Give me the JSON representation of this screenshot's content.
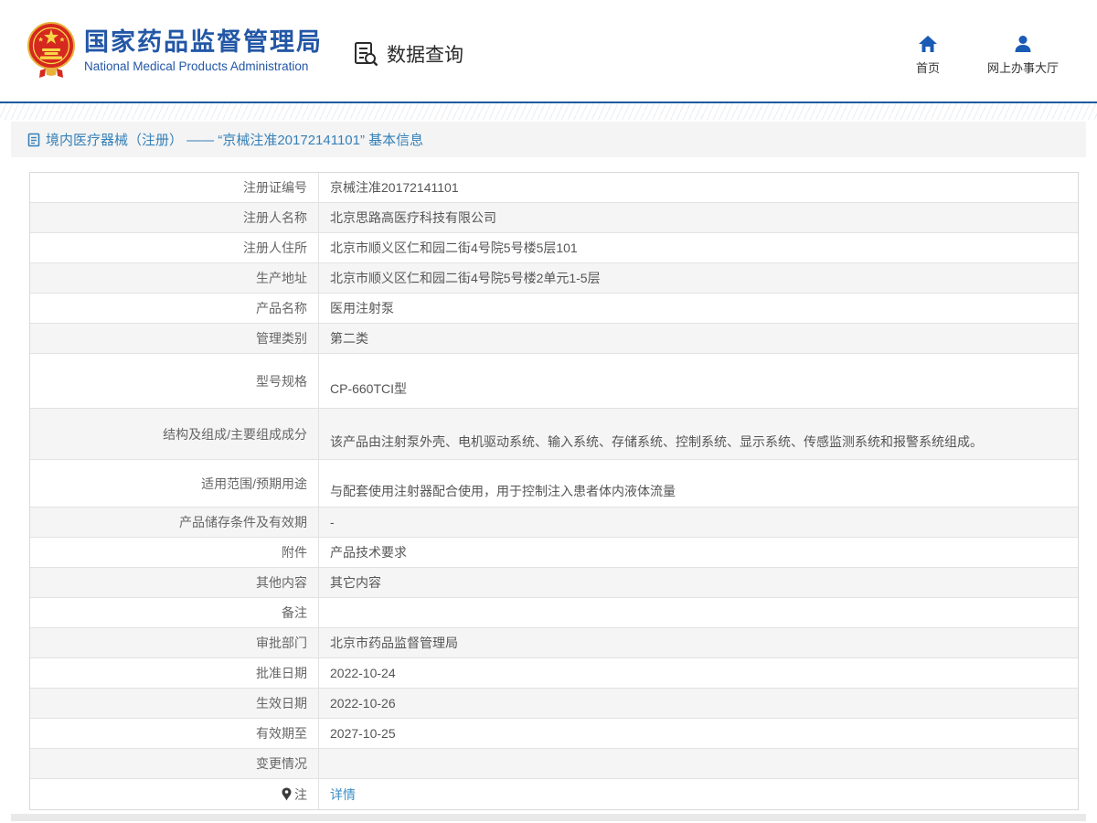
{
  "header": {
    "org_title": "国家药品监督管理局",
    "org_subtitle": "National Medical Products Administration",
    "data_query_label": "数据查询",
    "nav_home_label": "首页",
    "nav_hall_label": "网上办事大厅"
  },
  "section": {
    "title": "境内医疗器械（注册） —— “京械注准20172141101” 基本信息"
  },
  "table": {
    "rows": [
      {
        "label": "注册证编号",
        "value": "京械注准20172141101"
      },
      {
        "label": "注册人名称",
        "value": "北京思路高医疗科技有限公司"
      },
      {
        "label": "注册人住所",
        "value": "北京市顺义区仁和园二街4号院5号楼5层101"
      },
      {
        "label": "生产地址",
        "value": "北京市顺义区仁和园二街4号院5号楼2单元1-5层"
      },
      {
        "label": "产品名称",
        "value": "医用注射泵"
      },
      {
        "label": "管理类别",
        "value": "第二类"
      },
      {
        "label": "型号规格",
        "value": "CP-660TCI型"
      },
      {
        "label": "结构及组成/主要组成成分",
        "value": "该产品由注射泵外壳、电机驱动系统、输入系统、存储系统、控制系统、显示系统、传感监测系统和报警系统组成。"
      },
      {
        "label": "适用范围/预期用途",
        "value": "与配套使用注射器配合使用，用于控制注入患者体内液体流量"
      },
      {
        "label": "产品储存条件及有效期",
        "value": "-"
      },
      {
        "label": "附件",
        "value": "产品技术要求"
      },
      {
        "label": "其他内容",
        "value": "其它内容"
      },
      {
        "label": "备注",
        "value": ""
      },
      {
        "label": "审批部门",
        "value": "北京市药品监督管理局"
      },
      {
        "label": "批准日期",
        "value": "2022-10-24"
      },
      {
        "label": "生效日期",
        "value": "2022-10-26"
      },
      {
        "label": "有效期至",
        "value": "2027-10-25"
      },
      {
        "label": "变更情况",
        "value": ""
      },
      {
        "label": "注",
        "value": "详情"
      }
    ]
  },
  "colors": {
    "brand_blue": "#2357A6",
    "icon_blue": "#1A5BB5",
    "section_blue": "#3580B8",
    "link_blue": "#3C8DC5",
    "alt_row_bg": "#F5F5F5",
    "emblem_red": "#D5281E",
    "emblem_gold": "#F9D648"
  }
}
